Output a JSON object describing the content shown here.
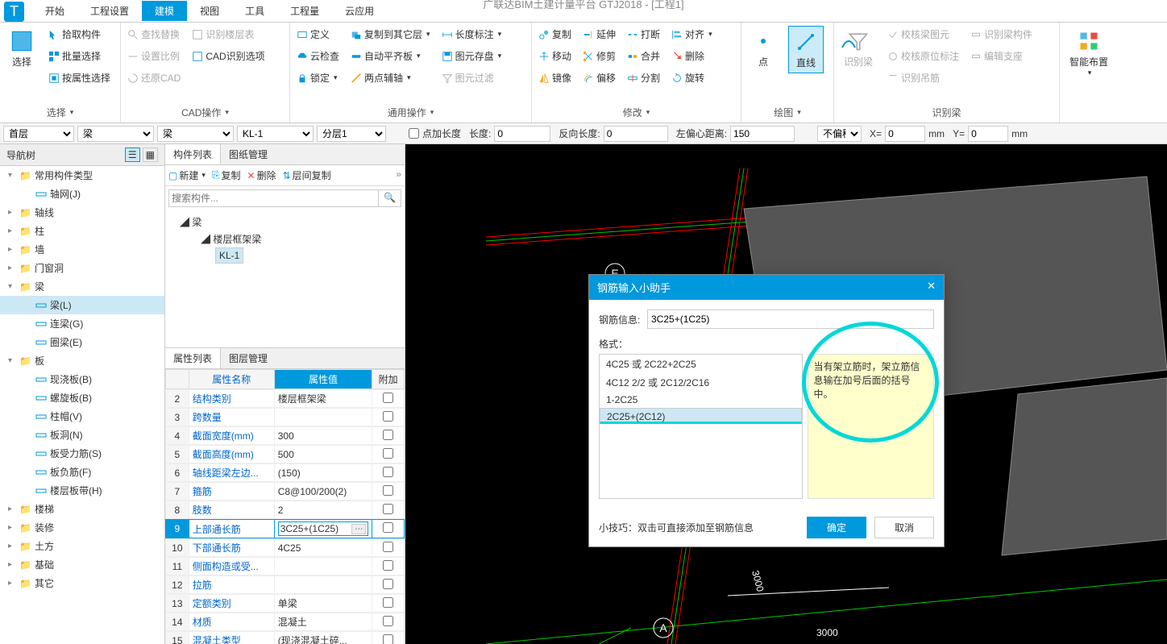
{
  "title": "广联达BIM土建计量平台 GTJ2018 - [工程1]",
  "tabs": [
    "开始",
    "工程设置",
    "建模",
    "视图",
    "工具",
    "工程量",
    "云应用"
  ],
  "active_tab": 2,
  "ribbon": {
    "select": {
      "big": "选择",
      "items": [
        "拾取构件",
        "批量选择",
        "按属性选择"
      ],
      "label": "选择"
    },
    "cad": {
      "items": [
        "查找替换",
        "识别楼层表",
        "设置比例",
        "CAD识别选项",
        "还原CAD"
      ],
      "label": "CAD操作"
    },
    "general": {
      "items": [
        "定义",
        "复制到其它层",
        "长度标注",
        "云检查",
        "自动平齐板",
        "图元存盘",
        "锁定",
        "两点辅轴",
        "图元过滤"
      ],
      "label": "通用操作"
    },
    "modify": {
      "items": [
        "复制",
        "延伸",
        "打断",
        "对齐",
        "移动",
        "修剪",
        "合并",
        "删除",
        "镜像",
        "偏移",
        "分割",
        "旋转"
      ],
      "label": "修改"
    },
    "draw": {
      "point": "点",
      "line": "直线",
      "label": "绘图"
    },
    "identify": {
      "big": "识别梁",
      "items": [
        "校核梁图元",
        "识别梁构件",
        "校核原位标注",
        "编辑支座",
        "识别吊筋"
      ],
      "label": "识别梁"
    },
    "smart": "智能布置"
  },
  "toolbar": {
    "floor": "首层",
    "type": "梁",
    "type2": "梁",
    "component": "KL-1",
    "layer": "分层1",
    "chk_pointlen": "点加长度",
    "len_label": "长度:",
    "len": "0",
    "rev_label": "反向长度:",
    "rev": "0",
    "offset_label": "左偏心距离:",
    "offset": "150",
    "nooffset": "不偏移",
    "x_label": "X=",
    "x": "0",
    "y_label": "Y=",
    "y": "0",
    "mm": "mm"
  },
  "nav": {
    "title": "导航树",
    "categories": [
      {
        "label": "常用构件类型",
        "level": 1,
        "exp": "▾",
        "children": [
          {
            "label": "轴网(J)",
            "level": 2,
            "ico": "grid"
          }
        ]
      },
      {
        "label": "轴线",
        "level": 1,
        "exp": "▸"
      },
      {
        "label": "柱",
        "level": 1,
        "exp": "▸"
      },
      {
        "label": "墙",
        "level": 1,
        "exp": "▸"
      },
      {
        "label": "门窗洞",
        "level": 1,
        "exp": "▸"
      },
      {
        "label": "梁",
        "level": 1,
        "exp": "▾",
        "children": [
          {
            "label": "梁(L)",
            "level": 2,
            "sel": true,
            "ico": "beam"
          },
          {
            "label": "连梁(G)",
            "level": 2,
            "ico": "beam"
          },
          {
            "label": "圈梁(E)",
            "level": 2,
            "ico": "beam"
          }
        ]
      },
      {
        "label": "板",
        "level": 1,
        "exp": "▾",
        "children": [
          {
            "label": "现浇板(B)",
            "level": 2
          },
          {
            "label": "螺旋板(B)",
            "level": 2
          },
          {
            "label": "柱帽(V)",
            "level": 2
          },
          {
            "label": "板洞(N)",
            "level": 2
          },
          {
            "label": "板受力筋(S)",
            "level": 2
          },
          {
            "label": "板负筋(F)",
            "level": 2
          },
          {
            "label": "楼层板带(H)",
            "level": 2
          }
        ]
      },
      {
        "label": "楼梯",
        "level": 1,
        "exp": "▸"
      },
      {
        "label": "装修",
        "level": 1,
        "exp": "▸"
      },
      {
        "label": "土方",
        "level": 1,
        "exp": "▸"
      },
      {
        "label": "基础",
        "level": 1,
        "exp": "▸"
      },
      {
        "label": "其它",
        "level": 1,
        "exp": "▸"
      }
    ]
  },
  "clist": {
    "tab1": "构件列表",
    "tab2": "图纸管理",
    "new": "新建",
    "copy": "复制",
    "del": "删除",
    "floorcopy": "层间复制",
    "search_ph": "搜索构件...",
    "root": "梁",
    "child": "楼层框架梁",
    "item": "KL-1"
  },
  "props": {
    "tab1": "属性列表",
    "tab2": "图层管理",
    "head_name": "属性名称",
    "head_val": "属性值",
    "head_att": "附加",
    "rows": [
      {
        "n": "2",
        "name": "结构类别",
        "val": "楼层框架梁"
      },
      {
        "n": "3",
        "name": "跨数量",
        "val": ""
      },
      {
        "n": "4",
        "name": "截面宽度(mm)",
        "val": "300"
      },
      {
        "n": "5",
        "name": "截面高度(mm)",
        "val": "500"
      },
      {
        "n": "6",
        "name": "轴线距梁左边...",
        "val": "(150)"
      },
      {
        "n": "7",
        "name": "箍筋",
        "val": "C8@100/200(2)"
      },
      {
        "n": "8",
        "name": "肢数",
        "val": "2"
      },
      {
        "n": "9",
        "name": "上部通长筋",
        "val": "3C25+(1C25)",
        "active": true
      },
      {
        "n": "10",
        "name": "下部通长筋",
        "val": "4C25"
      },
      {
        "n": "11",
        "name": "侧面构造或受...",
        "val": ""
      },
      {
        "n": "12",
        "name": "拉筋",
        "val": ""
      },
      {
        "n": "13",
        "name": "定额类别",
        "val": "单梁"
      },
      {
        "n": "14",
        "name": "材质",
        "val": "混凝土"
      },
      {
        "n": "15",
        "name": "混凝土类型",
        "val": "(现浇混凝土碎..."
      }
    ]
  },
  "dialog": {
    "title": "钢筋输入小助手",
    "field_label": "钢筋信息:",
    "field_val": "3C25+(1C25)",
    "format_label": "格式：",
    "formats": [
      "4C25 或 2C22+2C25",
      "4C12 2/2 或 2C12/2C16",
      "1-2C25",
      "2C25+(2C12)"
    ],
    "format_sel": 3,
    "help": "当有架立筋时，架立筋信息输在加号后面的括号中。",
    "tip": "小技巧：双击可直接添加至钢筋信息",
    "ok": "确定",
    "cancel": "取消"
  },
  "canvas": {
    "labelE": "E",
    "labelA": "A",
    "num3000a": "3000",
    "num3000b": "3000"
  }
}
